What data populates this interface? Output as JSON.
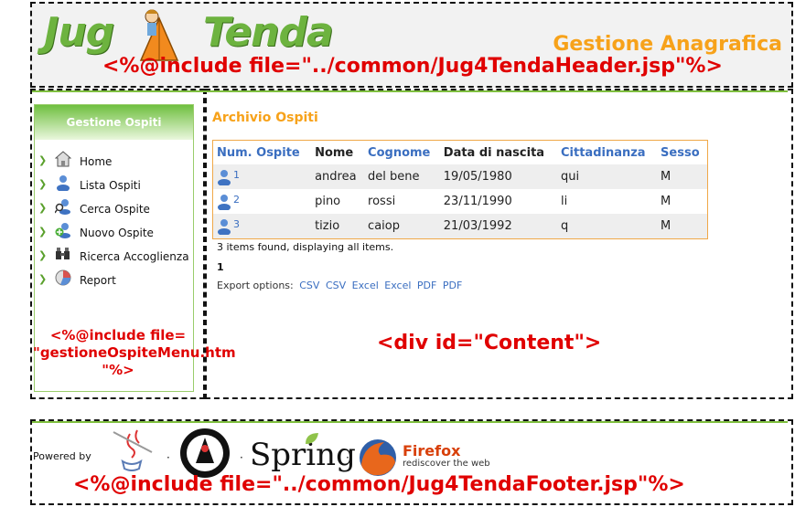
{
  "header": {
    "logo_left": "Jug",
    "logo_right": "Tenda",
    "title": "Gestione Anagrafica",
    "include": "<%@include file=\"../common/Jug4TendaHeader.jsp\"%>"
  },
  "menu": {
    "heading": "Gestione Ospiti",
    "items": [
      {
        "label": "Home",
        "icon": "house-icon"
      },
      {
        "label": "Lista Ospiti",
        "icon": "users-icon"
      },
      {
        "label": "Cerca Ospite",
        "icon": "search-user-icon"
      },
      {
        "label": "Nuovo Ospite",
        "icon": "add-user-icon"
      },
      {
        "label": "Ricerca Accoglienza",
        "icon": "binoculars-icon"
      },
      {
        "label": "Report",
        "icon": "chart-icon"
      }
    ],
    "include_line1": "<%@include file=",
    "include_line2": "\"gestioneOspiteMenu.htm",
    "include_line3": "\"%>"
  },
  "content": {
    "title": "Archivio Ospiti",
    "columns": [
      "Num. Ospite",
      "Nome",
      "Cognome",
      "Data di nascita",
      "Cittadinanza",
      "Sesso"
    ],
    "rows": [
      {
        "id": "1",
        "nome": "andrea",
        "cognome": "del bene",
        "data": "19/05/1980",
        "cittadinanza": "qui",
        "sesso": "M"
      },
      {
        "id": "2",
        "nome": "pino",
        "cognome": "rossi",
        "data": "23/11/1990",
        "cittadinanza": "li",
        "sesso": "M"
      },
      {
        "id": "3",
        "nome": "tizio",
        "cognome": "caiop",
        "data": "21/03/1992",
        "cittadinanza": "q",
        "sesso": "M"
      }
    ],
    "items_found": "3 items found, displaying all items.",
    "page": "1",
    "export_label": "Export options:",
    "export_links": [
      "CSV",
      "CSV",
      "Excel",
      "Excel",
      "PDF",
      "PDF"
    ],
    "include": "<div id=\"Content\">"
  },
  "footer": {
    "powered_by": "Powered by",
    "spring": "Spring",
    "firefox": "Firefox",
    "firefox_tagline": "rediscover the web",
    "include": "<%@include file=\"../common/Jug4TendaFooter.jsp\"%>"
  },
  "colors": {
    "accent_orange": "#f7a21a",
    "brand_green": "#6db33f",
    "link_blue": "#3a6ec0",
    "annotation_red": "#e00000"
  }
}
